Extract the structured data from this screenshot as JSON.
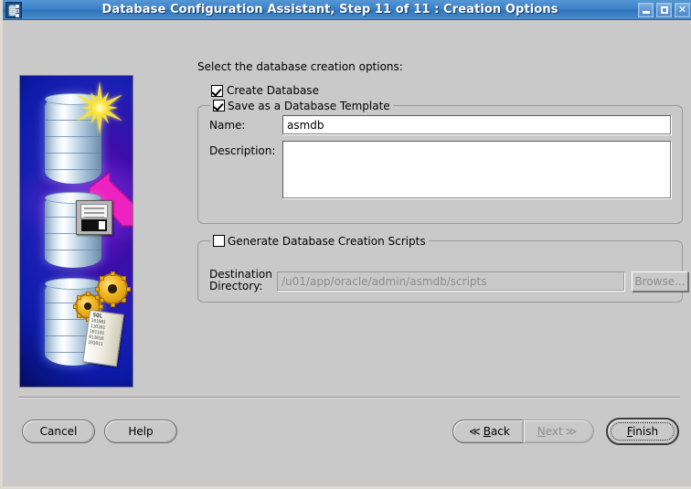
{
  "window": {
    "title": "Database Configuration Assistant, Step 11 of 11 : Creation Options",
    "app_icon": "database-app-icon",
    "controls": {
      "minimize": "minimize-icon",
      "maximize": "maximize-icon",
      "close": "✕"
    }
  },
  "sidebar": {
    "graphic": "oracle-database-creation-illustration",
    "scroll_label": "SQL",
    "scroll_bits": [
      "101001",
      "110101",
      "101101",
      "011010",
      "101011"
    ]
  },
  "main": {
    "intro": "Select the database creation options:",
    "create_database": {
      "label": "Create Database",
      "checked": true
    },
    "template_group": {
      "title": "Save as a Database Template",
      "checked": true,
      "name_label": "Name:",
      "name_value": "asmdb",
      "description_label": "Description:",
      "description_value": ""
    },
    "scripts_group": {
      "title": "Generate Database Creation Scripts",
      "checked": false,
      "destination_label_line1": "Destination",
      "destination_label_line2": "Directory:",
      "destination_value": "/u01/app/oracle/admin/asmdb/scripts",
      "browse_label": "Browse...",
      "enabled": false
    }
  },
  "buttons": {
    "cancel": "Cancel",
    "help": "Help",
    "back": "Back",
    "back_mnemonic": "B",
    "back_arrow": "≪",
    "next": "Next",
    "next_mnemonic": "N",
    "next_arrow": "≫",
    "next_disabled": true,
    "finish": "Finish",
    "finish_mnemonic": "F",
    "finish_focused": true
  },
  "colors": {
    "titlebar": "#3d82c8",
    "background": "#c9c9c9",
    "accent_magenta": "#ee22c0",
    "accent_yellow": "#f5e03a",
    "field_white": "#ffffff",
    "disabled_text": "#8c8c8c"
  }
}
